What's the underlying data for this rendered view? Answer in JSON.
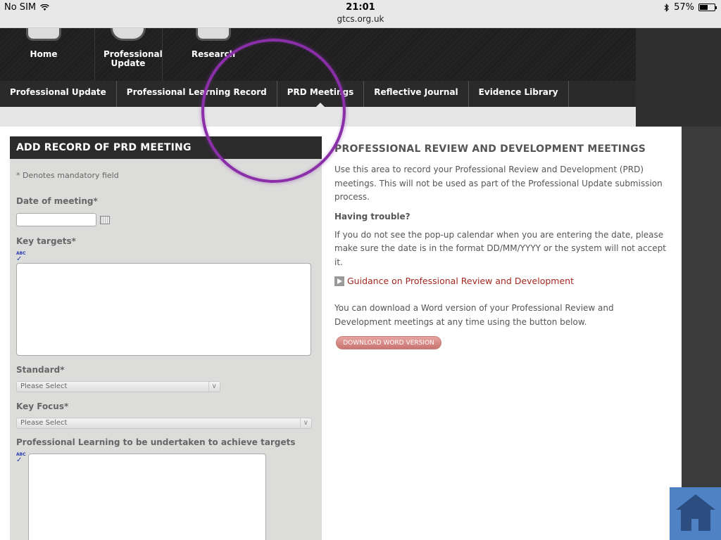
{
  "status_bar": {
    "carrier": "No SIM",
    "time": "21:01",
    "url": "gtcs.org.uk",
    "battery": "57%",
    "battery_level": 0.57
  },
  "header": {
    "items": [
      {
        "label": "Home"
      },
      {
        "label": "Professional Update"
      },
      {
        "label": "Research"
      }
    ]
  },
  "nav": {
    "items": [
      {
        "label": "Professional Update",
        "active": false
      },
      {
        "label": "Professional Learning Record",
        "active": false
      },
      {
        "label": "PRD Meetings",
        "active": true
      },
      {
        "label": "Reflective Journal",
        "active": false
      },
      {
        "label": "Evidence Library",
        "active": false
      }
    ]
  },
  "form": {
    "title": "ADD RECORD OF PRD MEETING",
    "mandatory_note": "* Denotes mandatory field",
    "date_label": "Date of meeting*",
    "key_targets_label": "Key targets*",
    "standard_label": "Standard*",
    "standard_value": "Please Select",
    "key_focus_label": "Key Focus*",
    "key_focus_value": "Please Select",
    "learning_label": "Professional Learning to be undertaken to achieve targets",
    "spell_icon_text": "ABC"
  },
  "info": {
    "title": "PROFESSIONAL REVIEW AND DEVELOPMENT MEETINGS",
    "intro": "Use this area to record your Professional Review and Development (PRD) meetings. This will not be used as part of the Professional Update submission process.",
    "trouble_heading": "Having trouble?",
    "trouble_text": "If you do not see the pop-up calendar when you are entering the date, please make sure the date is in the format DD/MM/YYYY or the system will not accept it.",
    "guidance_link": "Guidance on Professional Review and Development",
    "download_text": "You can download a Word version of your Professional Review and Development meetings at any time using the button below.",
    "download_button": "DOWNLOAD WORD VERSION"
  },
  "colors": {
    "link": "#a5281f",
    "magnifier": "#8a2fa8",
    "home_button": "#4f82c5"
  }
}
